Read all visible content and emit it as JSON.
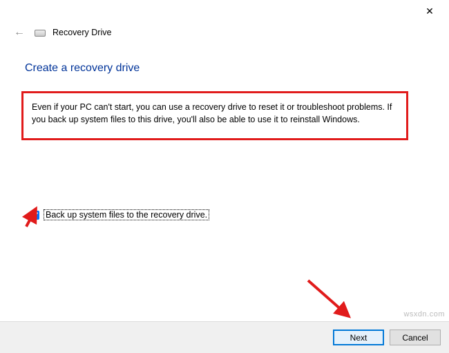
{
  "window": {
    "header_title": "Recovery Drive",
    "close_symbol": "✕"
  },
  "page": {
    "title": "Create a recovery drive",
    "info_text": "Even if your PC can't start, you can use a recovery drive to reset it or troubleshoot problems. If you back up system files to this drive, you'll also be able to use it to reinstall Windows."
  },
  "checkbox": {
    "label": "Back up system files to the recovery drive.",
    "checked": true
  },
  "buttons": {
    "next": "Next",
    "cancel": "Cancel"
  },
  "watermark": "wsxdn.com",
  "colors": {
    "highlight_border": "#e11b1b",
    "title_blue": "#003399",
    "primary_border": "#0078d7"
  }
}
